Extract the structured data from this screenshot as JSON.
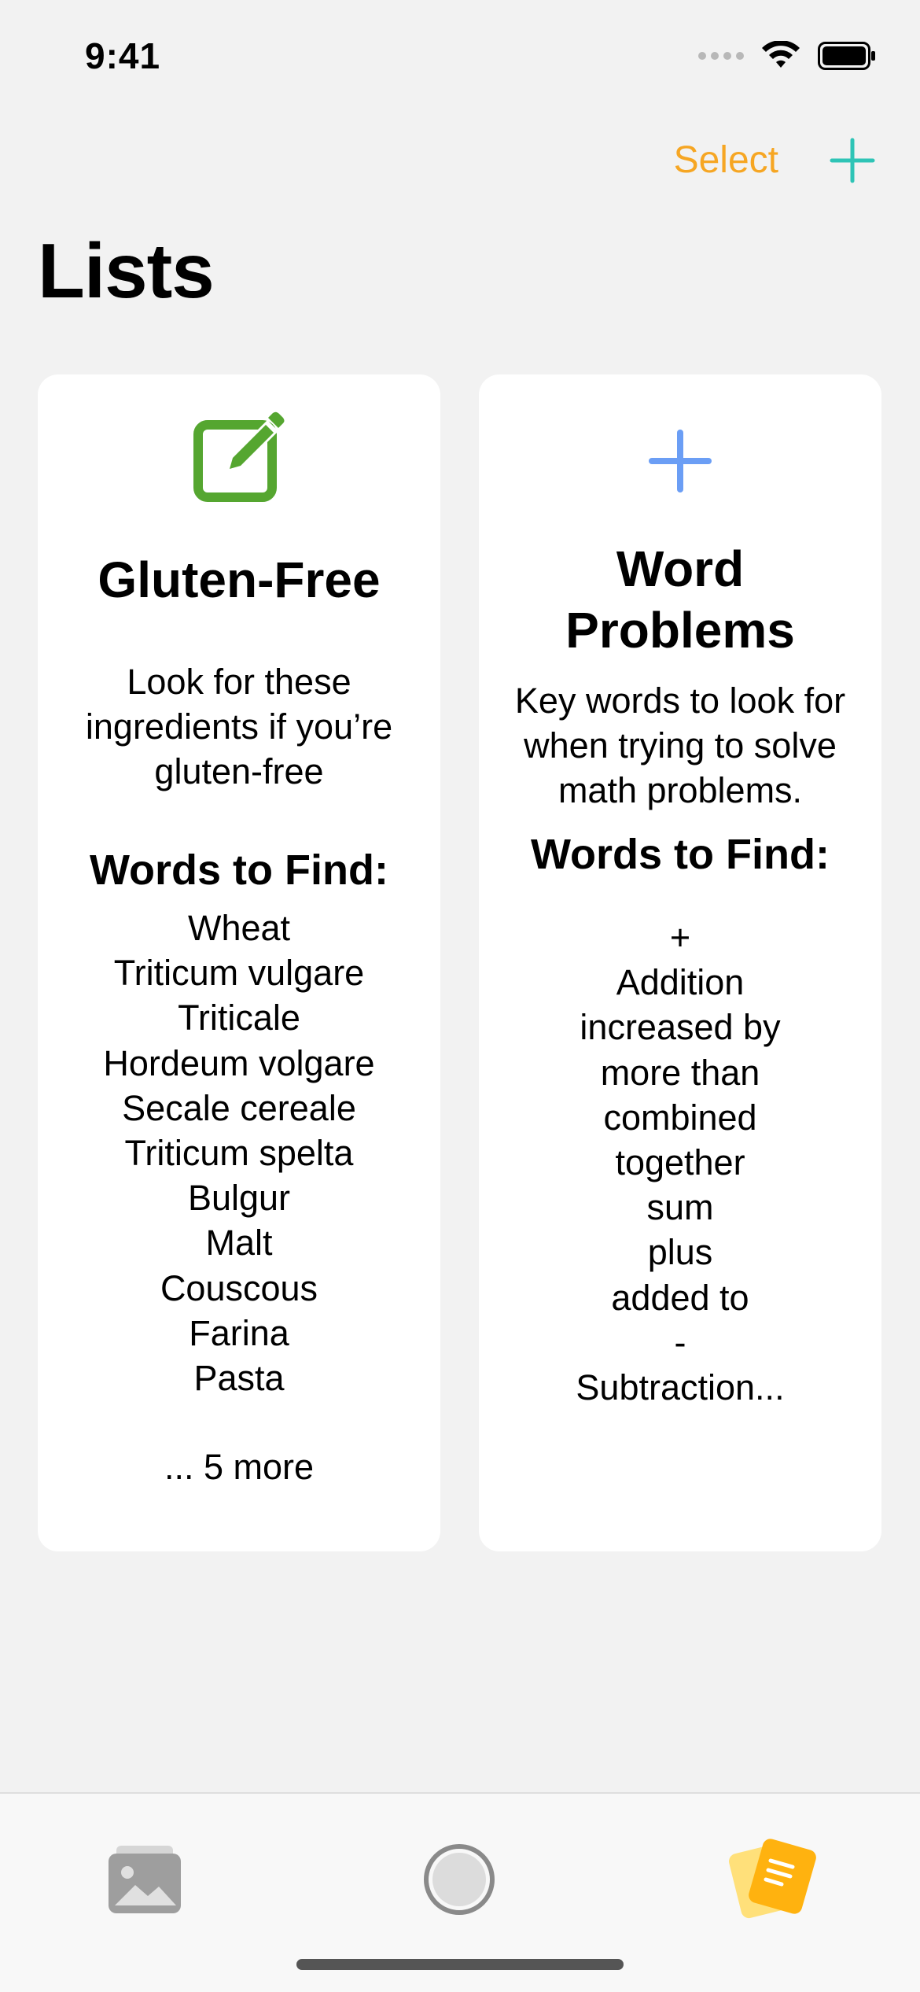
{
  "status": {
    "time": "9:41"
  },
  "nav": {
    "select_label": "Select"
  },
  "page": {
    "title": "Lists"
  },
  "cards": [
    {
      "title": "Gluten-Free",
      "description": "Look for these ingredients if you’re gluten-free",
      "words_heading": "Words to Find:",
      "words": [
        "Wheat",
        "Triticum vulgare",
        "Triticale",
        "Hordeum volgare",
        "Secale cereale",
        "Triticum spelta",
        "Bulgur",
        "Malt",
        "Couscous",
        "Farina",
        "Pasta"
      ],
      "more": "... 5 more",
      "icon": "edit-icon",
      "icon_color": "#55a630"
    },
    {
      "title": "Word Problems",
      "description": "Key words to look for when trying to solve math problems.",
      "words_heading": "Words to Find:",
      "words": [
        "+",
        "Addition",
        "increased by",
        "more than",
        "combined",
        "together",
        "sum",
        "plus",
        "added to",
        "-",
        "Subtraction..."
      ],
      "icon": "plus-icon",
      "icon_color": "#6b9ef5"
    }
  ],
  "tabs": [
    {
      "name": "photos",
      "icon": "photo-icon"
    },
    {
      "name": "camera",
      "icon": "shutter-icon"
    },
    {
      "name": "lists",
      "icon": "lists-icon",
      "selected": true
    }
  ],
  "colors": {
    "accent_orange": "#f6a623",
    "accent_teal": "#2ec4b6",
    "background": "#f2f2f2",
    "card": "#ffffff",
    "lists_tab": "#ffb20f"
  }
}
